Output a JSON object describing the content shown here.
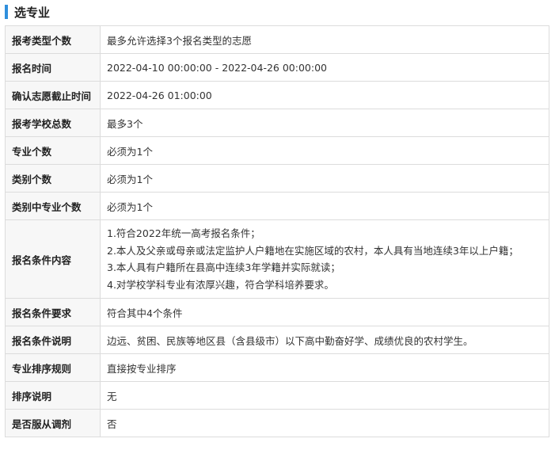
{
  "section": {
    "title": "选专业",
    "accent_color": "#2f8fdc"
  },
  "rows": [
    {
      "label": "报考类型个数",
      "value": "最多允许选择3个报名类型的志愿"
    },
    {
      "label": "报名时间",
      "value": "2022-04-10 00:00:00 - 2022-04-26 00:00:00"
    },
    {
      "label": "确认志愿截止时间",
      "value": "2022-04-26 01:00:00"
    },
    {
      "label": "报考学校总数",
      "value": "最多3个"
    },
    {
      "label": "专业个数",
      "value": "必须为1个"
    },
    {
      "label": "类别个数",
      "value": "必须为1个"
    },
    {
      "label": "类别中专业个数",
      "value": "必须为1个"
    },
    {
      "label": "报名条件内容",
      "lines": [
        "1.符合2022年统一高考报名条件；",
        "2.本人及父亲或母亲或法定监护人户籍地在实施区域的农村，本人具有当地连续3年以上户籍；",
        "3.本人具有户籍所在县高中连续3年学籍并实际就读；",
        "4.对学校学科专业有浓厚兴趣，符合学科培养要求。"
      ]
    },
    {
      "label": "报名条件要求",
      "value": "符合其中4个条件"
    },
    {
      "label": "报名条件说明",
      "value": "边远、贫困、民族等地区县（含县级市）以下高中勤奋好学、成绩优良的农村学生。"
    },
    {
      "label": "专业排序规则",
      "value": "直接按专业排序"
    },
    {
      "label": "排序说明",
      "value": "无"
    },
    {
      "label": "是否服从调剂",
      "value": "否"
    }
  ]
}
